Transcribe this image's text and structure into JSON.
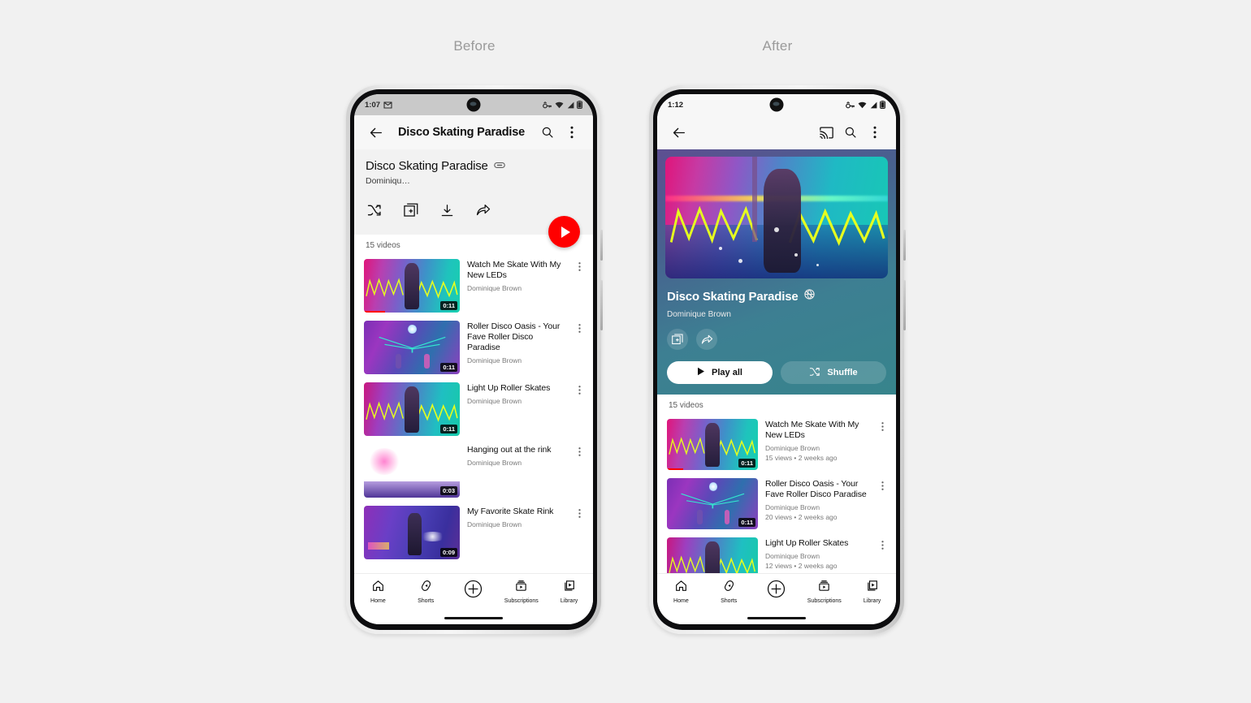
{
  "captions": {
    "before": "Before",
    "after": "After"
  },
  "before": {
    "status": {
      "time": "1:07",
      "icons": [
        "messages-icon",
        "vpn-key-icon",
        "wifi-icon",
        "signal-icon",
        "battery-icon"
      ]
    },
    "appbar": {
      "back": "back-arrow-icon",
      "title": "Disco Skating Paradise",
      "search": "search-icon",
      "overflow": "more-vert-icon"
    },
    "playlist": {
      "title": "Disco Skating Paradise",
      "privacy_icon": "link-unlisted-icon",
      "owner": "Dominiqu…",
      "actions": [
        "shuffle-icon",
        "save-to-library-icon",
        "download-icon",
        "share-icon"
      ],
      "fab": "play-fab",
      "count": "15 videos"
    },
    "videos": [
      {
        "title": "Watch Me Skate With My New LEDs",
        "channel": "Dominique Brown",
        "duration": "0:11",
        "progress": 22
      },
      {
        "title": "Roller Disco Oasis - Your Fave Roller Disco Paradise",
        "channel": "Dominique Brown",
        "duration": "0:11",
        "progress": 0
      },
      {
        "title": "Light Up Roller Skates",
        "channel": "Dominique Brown",
        "duration": "0:11",
        "progress": 0
      },
      {
        "title": "Hanging out at the rink",
        "channel": "Dominique Brown",
        "duration": "0:03",
        "progress": 0
      },
      {
        "title": "My Favorite Skate Rink",
        "channel": "Dominique Brown",
        "duration": "0:09",
        "progress": 0
      }
    ],
    "nav": [
      {
        "label": "Home",
        "icon": "home-icon"
      },
      {
        "label": "Shorts",
        "icon": "shorts-icon"
      },
      {
        "label": "",
        "icon": "create-plus-icon"
      },
      {
        "label": "Subscriptions",
        "icon": "subscriptions-icon"
      },
      {
        "label": "Library",
        "icon": "library-icon"
      }
    ]
  },
  "after": {
    "status": {
      "time": "1:12",
      "icons": [
        "messages-icon",
        "vpn-key-icon",
        "wifi-icon",
        "signal-icon",
        "battery-icon"
      ]
    },
    "appbar": {
      "back": "back-arrow-icon",
      "cast": "cast-icon",
      "search": "search-icon",
      "overflow": "more-vert-icon"
    },
    "hero": {
      "title": "Disco Skating Paradise",
      "privacy_icon": "private-globe-icon",
      "owner": "Dominique Brown",
      "actions": [
        "save-to-library-icon",
        "share-icon"
      ],
      "play_all": "Play all",
      "shuffle": "Shuffle"
    },
    "count": "15 videos",
    "videos": [
      {
        "title": "Watch Me Skate With My New LEDs",
        "channel": "Dominique Brown",
        "stats": "15 views • 2 weeks ago",
        "duration": "0:11",
        "progress": 18
      },
      {
        "title": "Roller Disco Oasis - Your Fave Roller Disco Paradise",
        "channel": "Dominique Brown",
        "stats": "20 views • 2 weeks ago",
        "duration": "0:11",
        "progress": 0
      },
      {
        "title": "Light Up Roller Skates",
        "channel": "Dominique Brown",
        "stats": "12 views • 2 weeks ago",
        "duration": "0:11",
        "progress": 0
      }
    ],
    "nav": [
      {
        "label": "Home",
        "icon": "home-icon"
      },
      {
        "label": "Shorts",
        "icon": "shorts-icon"
      },
      {
        "label": "",
        "icon": "create-plus-icon"
      },
      {
        "label": "Subscriptions",
        "icon": "subscriptions-icon"
      },
      {
        "label": "Library",
        "icon": "library-icon"
      }
    ]
  },
  "colors": {
    "page_bg": "#f1f1f1",
    "youtube_red": "#ff0000",
    "caption_gray": "#9a9a9a",
    "text_primary": "#0f0f0f",
    "text_secondary": "#7a7a7a"
  }
}
